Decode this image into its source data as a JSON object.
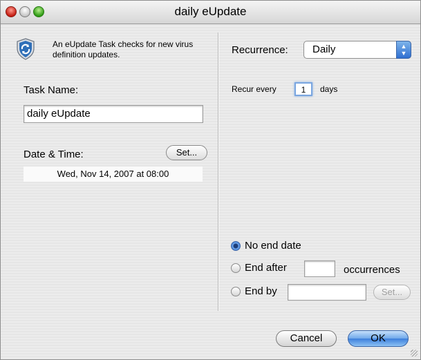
{
  "window": {
    "title": "daily eUpdate"
  },
  "info": {
    "text": "An eUpdate Task checks for new virus definition updates."
  },
  "task": {
    "name_label": "Task Name:",
    "name_value": "daily eUpdate"
  },
  "datetime": {
    "label": "Date & Time:",
    "set_label": "Set...",
    "value": "Wed, Nov 14, 2007 at 08:00"
  },
  "recurrence": {
    "label": "Recurrence:",
    "selected": "Daily",
    "recur_prefix": "Recur every",
    "recur_value": "1",
    "recur_suffix": "days"
  },
  "end": {
    "options": [
      {
        "label": "No end date",
        "selected": true
      },
      {
        "label": "End after",
        "selected": false
      },
      {
        "label": "End by",
        "selected": false
      }
    ],
    "occurrences_suffix": "occurrences",
    "end_after_value": "",
    "end_by_value": "",
    "end_by_set_label": "Set..."
  },
  "buttons": {
    "cancel": "Cancel",
    "ok": "OK"
  },
  "icons": {
    "window_close": "close-icon",
    "window_minimize": "minimize-icon",
    "window_zoom": "zoom-icon",
    "eupdate": "shield-refresh-icon",
    "popup_arrows": "updown-arrows-icon"
  }
}
